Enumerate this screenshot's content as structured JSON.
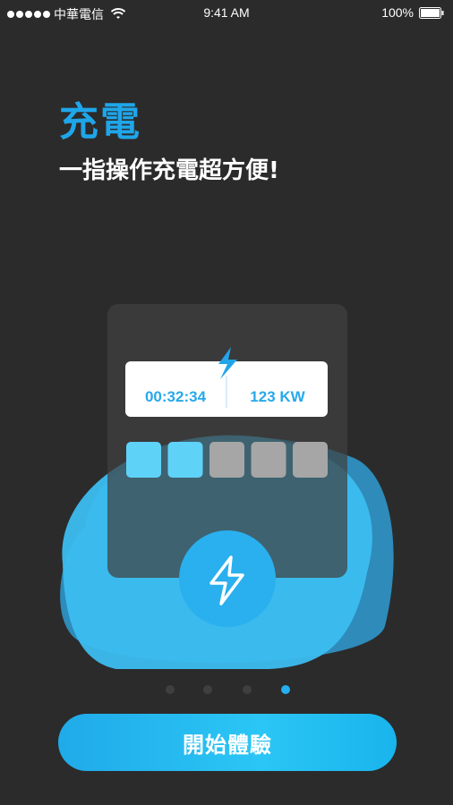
{
  "status_bar": {
    "carrier": "中華電信",
    "time": "9:41 AM",
    "battery": "100%"
  },
  "title": "充電",
  "subtitle": "一指操作充電超方便!",
  "illustration": {
    "timer": "00:32:34",
    "power": "123 KW",
    "progress": {
      "filled": 2,
      "total": 5
    }
  },
  "pagination": {
    "count": 4,
    "active_index": 3
  },
  "start_button": {
    "label": "開始體驗"
  },
  "colors": {
    "background": "#2b2b2b",
    "accent": "#1fa6ea",
    "cloud": "#38b8ee",
    "dot_inactive": "#3f3f3f"
  },
  "icons": [
    "wifi-icon",
    "battery-icon",
    "lightning-icon"
  ]
}
